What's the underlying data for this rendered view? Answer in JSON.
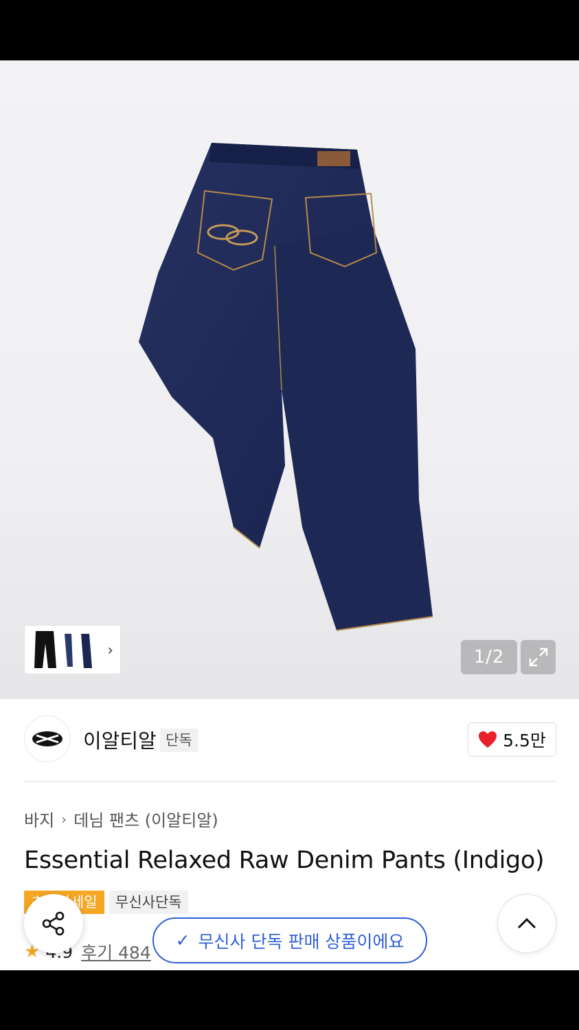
{
  "gallery": {
    "page_current": "1",
    "page_separator": "/",
    "page_total": "2",
    "thumb_more": "›"
  },
  "brand": {
    "name": "이알티알",
    "exclusive_tag": "단독",
    "like_count": "5.5만"
  },
  "breadcrumb": {
    "category": "바지",
    "separator": "›",
    "subcategory": "데님 팬츠 (이알티알)"
  },
  "product": {
    "title": "Essential Relaxed Raw Denim Pants (Indigo)",
    "badge_sale": "초특가세일",
    "badge_musinsa": "무신사단독",
    "rating": "4.9",
    "reviews": "후기 484"
  },
  "toast": {
    "check_icon": "✓",
    "message": "무신사 단독 판매 상품이에요"
  },
  "colors": {
    "accent_blue": "#2f5fd6",
    "sale_orange": "#f5a623",
    "heart_red": "#e8202a",
    "denim": "#1f2a5c"
  }
}
